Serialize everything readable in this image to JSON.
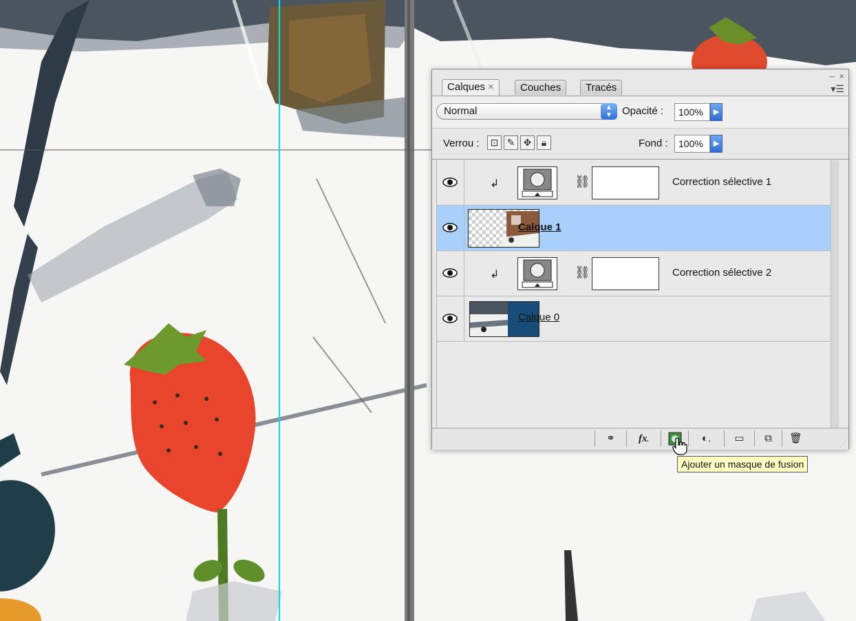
{
  "panel": {
    "tabs": [
      {
        "label": "Calques",
        "close": "×",
        "active": true
      },
      {
        "label": "Couches",
        "active": false
      },
      {
        "label": "Tracés",
        "active": false
      }
    ],
    "window_controls": {
      "minimize": "–",
      "close": "×"
    },
    "menu_icon": "panel-menu-icon",
    "blend_mode": "Normal",
    "opacity_label": "Opacité :",
    "opacity_value": "100%",
    "lock_label": "Verrou :",
    "fill_label": "Fond :",
    "fill_value": "100%",
    "layers": [
      {
        "name": "Correction sélective 1",
        "type": "adjustment",
        "visible": true,
        "clipped": true,
        "selected": false
      },
      {
        "name": "Calque 1",
        "type": "pixel",
        "visible": true,
        "selected": true
      },
      {
        "name": "Correction sélective 2",
        "type": "adjustment",
        "visible": true,
        "clipped": true,
        "selected": false
      },
      {
        "name": "Calque 0",
        "type": "pixel",
        "visible": true,
        "selected": false
      }
    ],
    "bottom_buttons": [
      "link-layers-icon",
      "fx-icon",
      "add-mask-icon",
      "adjustment-icon",
      "new-group-icon",
      "new-layer-icon",
      "trash-icon"
    ],
    "fx_label": "fx"
  },
  "tooltip": "Ajouter un masque de fusion",
  "colors": {
    "selection": "#a9d0fb",
    "guide": "#00e0f0",
    "accent": "#2f6fd3"
  }
}
